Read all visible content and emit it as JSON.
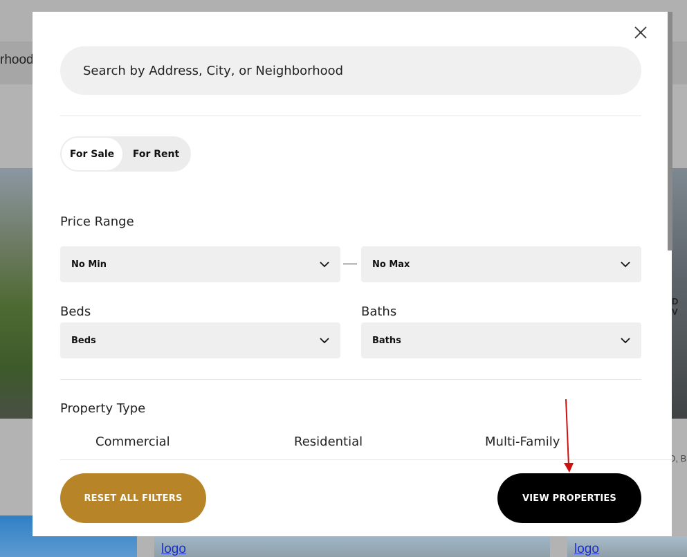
{
  "background": {
    "band_text": "rhood",
    "right_text": "D V",
    "right_text2": "D, B",
    "logos": [
      "logo",
      "logo"
    ]
  },
  "modal": {
    "search": {
      "placeholder": "Search by Address, City, or Neighborhood"
    },
    "listing_toggle": {
      "options": [
        "For Sale",
        "For Rent"
      ],
      "selected": "For Sale"
    },
    "price_range": {
      "label": "Price Range",
      "min": "No Min",
      "max": "No Max"
    },
    "beds": {
      "label": "Beds",
      "value": "Beds"
    },
    "baths": {
      "label": "Baths",
      "value": "Baths"
    },
    "property_type": {
      "label": "Property Type",
      "options": [
        "Commercial",
        "Residential",
        "Multi-Family"
      ]
    },
    "actions": {
      "reset": "RESET ALL FILTERS",
      "view": "VIEW PROPERTIES"
    }
  },
  "colors": {
    "reset_button": "#b78427",
    "view_button": "#000000",
    "annotation_arrow": "#cc1111"
  },
  "icons": {
    "close": "close-icon",
    "chevron": "chevron-down-icon"
  }
}
